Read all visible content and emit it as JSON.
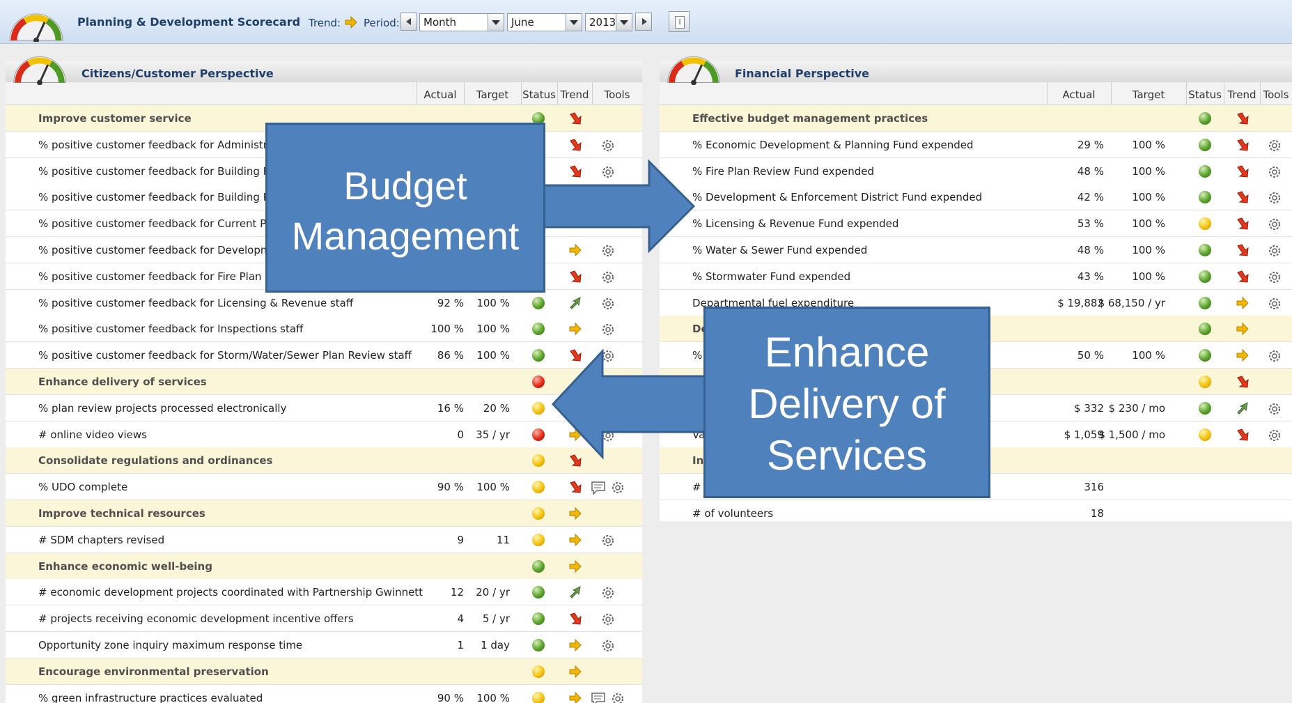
{
  "header": {
    "title": "Planning & Development Scorecard",
    "trend_label": "Trend:",
    "period_label": "Period:",
    "period_type": "Month",
    "month": "June",
    "year": "2013",
    "info_label": "i"
  },
  "colors": {
    "green": "#5aa22a",
    "yellow": "#f4c20d",
    "red": "#e22b16",
    "callout_fill": "#4f81bd",
    "objective_row": "#fcf6d8",
    "title_text": "#1f3f6a"
  },
  "columns": {
    "actual": "Actual",
    "target": "Target",
    "status": "Status",
    "trend": "Trend",
    "tools": "Tools"
  },
  "citizens": {
    "title": "Citizens/Customer Perspective",
    "rows": [
      {
        "type": "obj",
        "name": "Improve customer service",
        "actual": "",
        "target": "",
        "status": "green",
        "trend": "down",
        "tools": []
      },
      {
        "type": "kpi",
        "name": "% positive customer feedback for Administration",
        "actual": "",
        "target": "",
        "status": "",
        "trend": "down",
        "tools": [
          "gear-icon"
        ]
      },
      {
        "type": "kpi",
        "name": "% positive customer feedback for Building Permi",
        "actual": "",
        "target": "",
        "status": "",
        "trend": "down",
        "tools": [
          "gear-icon"
        ]
      },
      {
        "type": "kpi",
        "name": "% positive customer feedback for Building Plan R",
        "actual": "",
        "target": "",
        "status": "",
        "trend": "",
        "tools": []
      },
      {
        "type": "kpi",
        "name": "% positive customer feedback for Current Planni",
        "actual": "",
        "target": "",
        "status": "",
        "trend": "",
        "tools": []
      },
      {
        "type": "kpi",
        "name": "% positive customer feedback for Development F",
        "actual": "",
        "target": "",
        "status": "",
        "trend": "right",
        "tools": [
          "gear-icon"
        ]
      },
      {
        "type": "kpi",
        "name": "% positive customer feedback for Fire Plan Revie",
        "actual": "",
        "target": "",
        "status": "",
        "trend": "down",
        "tools": [
          "gear-icon"
        ]
      },
      {
        "type": "kpi",
        "name": "% positive customer feedback for Licensing & Revenue staff",
        "actual": "92 %",
        "target": "100 %",
        "status": "green",
        "trend": "up",
        "tools": [
          "gear-icon"
        ]
      },
      {
        "type": "kpi",
        "name": "% positive customer feedback for Inspections staff",
        "actual": "100 %",
        "target": "100 %",
        "status": "green",
        "trend": "right",
        "tools": [
          "gear-icon"
        ]
      },
      {
        "type": "kpi",
        "name": "% positive customer feedback for Storm/Water/Sewer Plan Review staff",
        "actual": "86 %",
        "target": "100 %",
        "status": "green",
        "trend": "down",
        "tools": [
          "gear-icon"
        ]
      },
      {
        "type": "obj",
        "name": "Enhance delivery of services",
        "actual": "",
        "target": "",
        "status": "red",
        "trend": "",
        "tools": []
      },
      {
        "type": "kpi",
        "name": "% plan review projects processed electronically",
        "actual": "16 %",
        "target": "20 %",
        "status": "yellow",
        "trend": "",
        "tools": []
      },
      {
        "type": "kpi",
        "name": "# online video views",
        "actual": "0",
        "target": "35 / yr",
        "status": "red",
        "trend": "right",
        "tools": [
          "gear-icon"
        ]
      },
      {
        "type": "obj",
        "name": "Consolidate regulations and ordinances",
        "actual": "",
        "target": "",
        "status": "yellow",
        "trend": "down",
        "tools": []
      },
      {
        "type": "kpi",
        "name": "% UDO complete",
        "actual": "90 %",
        "target": "100 %",
        "status": "yellow",
        "trend": "down",
        "tools": [
          "comment-icon",
          "gear-icon"
        ]
      },
      {
        "type": "obj",
        "name": "Improve technical resources",
        "actual": "",
        "target": "",
        "status": "yellow",
        "trend": "right",
        "tools": []
      },
      {
        "type": "kpi",
        "name": "# SDM chapters revised",
        "actual": "9",
        "target": "11",
        "status": "yellow",
        "trend": "right",
        "tools": [
          "gear-icon"
        ]
      },
      {
        "type": "obj",
        "name": "Enhance economic well-being",
        "actual": "",
        "target": "",
        "status": "green",
        "trend": "right",
        "tools": []
      },
      {
        "type": "kpi",
        "name": "# economic development projects coordinated with Partnership Gwinnett",
        "actual": "12",
        "target": "20 / yr",
        "status": "green",
        "trend": "up",
        "tools": [
          "gear-icon"
        ]
      },
      {
        "type": "kpi",
        "name": "# projects receiving economic development incentive offers",
        "actual": "4",
        "target": "5 / yr",
        "status": "green",
        "trend": "down",
        "tools": [
          "gear-icon"
        ]
      },
      {
        "type": "kpi",
        "name": "Opportunity zone inquiry maximum response time",
        "actual": "1",
        "target": "1 day",
        "status": "green",
        "trend": "right",
        "tools": [
          "gear-icon"
        ]
      },
      {
        "type": "obj",
        "name": "Encourage environmental preservation",
        "actual": "",
        "target": "",
        "status": "yellow",
        "trend": "right",
        "tools": []
      },
      {
        "type": "kpi",
        "name": "% green infrastructure practices evaluated",
        "actual": "90 %",
        "target": "100 %",
        "status": "yellow",
        "trend": "right",
        "tools": [
          "comment-icon",
          "gear-icon"
        ]
      }
    ]
  },
  "financial": {
    "title": "Financial Perspective",
    "rows": [
      {
        "type": "obj",
        "name": "Effective budget management practices",
        "actual": "",
        "target": "",
        "status": "green",
        "trend": "down",
        "tools": []
      },
      {
        "type": "kpi",
        "name": "% Economic Development & Planning Fund expended",
        "actual": "29 %",
        "target": "100 %",
        "status": "green",
        "trend": "down",
        "tools": [
          "gear-icon"
        ]
      },
      {
        "type": "kpi",
        "name": "% Fire Plan Review Fund expended",
        "actual": "48 %",
        "target": "100 %",
        "status": "green",
        "trend": "down",
        "tools": [
          "gear-icon"
        ]
      },
      {
        "type": "kpi",
        "name": "% Development & Enforcement District Fund expended",
        "actual": "42 %",
        "target": "100 %",
        "status": "green",
        "trend": "down",
        "tools": [
          "gear-icon"
        ]
      },
      {
        "type": "kpi",
        "name": "% Licensing & Revenue Fund expended",
        "actual": "53 %",
        "target": "100 %",
        "status": "yellow",
        "trend": "down",
        "tools": [
          "gear-icon"
        ]
      },
      {
        "type": "kpi",
        "name": "% Water & Sewer Fund expended",
        "actual": "48 %",
        "target": "100 %",
        "status": "green",
        "trend": "down",
        "tools": [
          "gear-icon"
        ]
      },
      {
        "type": "kpi",
        "name": "% Stormwater Fund expended",
        "actual": "43 %",
        "target": "100 %",
        "status": "green",
        "trend": "down",
        "tools": [
          "gear-icon"
        ]
      },
      {
        "type": "kpi",
        "name": "Departmental fuel expenditure",
        "actual": "$ 19,882",
        "target": "$ 68,150 / yr",
        "status": "green",
        "trend": "right",
        "tools": [
          "gear-icon"
        ]
      },
      {
        "type": "obj",
        "name": "De",
        "actual": "",
        "target": "",
        "status": "green",
        "trend": "right",
        "tools": []
      },
      {
        "type": "kpi",
        "name": "%",
        "actual": "50 %",
        "target": "100 %",
        "status": "green",
        "trend": "right",
        "tools": [
          "gear-icon"
        ]
      },
      {
        "type": "obj",
        "name": "",
        "actual": "",
        "target": "",
        "status": "yellow",
        "trend": "down",
        "tools": []
      },
      {
        "type": "kpi",
        "name": "",
        "actual": "$ 332",
        "target": "$ 230 / mo",
        "status": "green",
        "trend": "up",
        "tools": [
          "gear-icon"
        ]
      },
      {
        "type": "kpi",
        "name": "Va",
        "actual": "$ 1,059",
        "target": "$ 1,500 / mo",
        "status": "yellow",
        "trend": "down",
        "tools": [
          "gear-icon"
        ]
      },
      {
        "type": "obj",
        "name": "In",
        "actual": "",
        "target": "",
        "status": "",
        "trend": "",
        "tools": []
      },
      {
        "type": "kpi",
        "name": "#",
        "actual": "316",
        "target": "",
        "status": "",
        "trend": "",
        "tools": []
      },
      {
        "type": "kpi",
        "name": "# of volunteers",
        "actual": "18",
        "target": "",
        "status": "",
        "trend": "",
        "tools": []
      }
    ]
  },
  "callouts": {
    "budget": {
      "line1": "Budget",
      "line2": "Management"
    },
    "delivery": {
      "line1": "Enhance",
      "line2": "Delivery of",
      "line3": "Services"
    }
  }
}
